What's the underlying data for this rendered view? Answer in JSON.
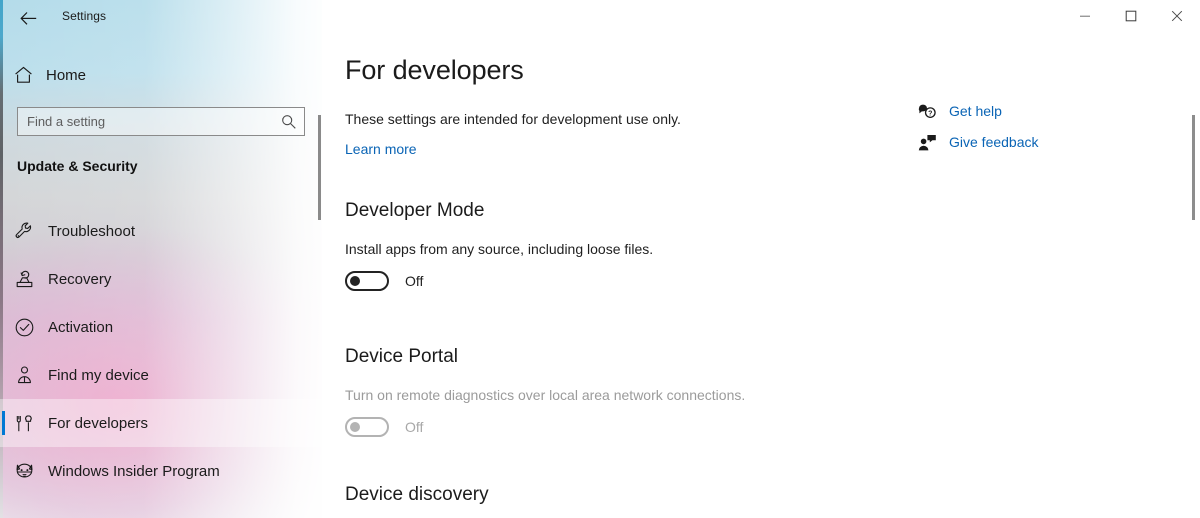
{
  "window": {
    "title": "Settings",
    "back_icon": "back-arrow-icon",
    "controls": {
      "minimize": "─",
      "maximize": "□",
      "close": "✕"
    }
  },
  "sidebar": {
    "home": {
      "label": "Home",
      "icon": "home-icon"
    },
    "search": {
      "value": "",
      "placeholder": "Find a setting",
      "icon": "search-icon"
    },
    "section_header": "Update & Security",
    "items": [
      {
        "label": "Troubleshoot",
        "icon": "wrench-icon",
        "selected": false
      },
      {
        "label": "Recovery",
        "icon": "recovery-icon",
        "selected": false
      },
      {
        "label": "Activation",
        "icon": "check-circle-icon",
        "selected": false
      },
      {
        "label": "Find my device",
        "icon": "find-device-icon",
        "selected": false
      },
      {
        "label": "For developers",
        "icon": "tools-icon",
        "selected": true
      },
      {
        "label": "Windows Insider Program",
        "icon": "ninjacat-icon",
        "selected": false
      }
    ]
  },
  "main": {
    "page_title": "For developers",
    "description": "These settings are intended for development use only.",
    "learn_more": "Learn more",
    "help_links": [
      {
        "label": "Get help",
        "icon": "help-bubble-icon"
      },
      {
        "label": "Give feedback",
        "icon": "feedback-person-icon"
      }
    ],
    "groups": [
      {
        "title": "Developer Mode",
        "description": "Install apps from any source, including loose files.",
        "toggle_state": "Off",
        "disabled": false
      },
      {
        "title": "Device Portal",
        "description": "Turn on remote diagnostics over local area network connections.",
        "toggle_state": "Off",
        "disabled": true
      },
      {
        "title": "Device discovery",
        "description": "",
        "toggle_state": "",
        "disabled": false
      }
    ]
  },
  "colors": {
    "accent": "#0078d4",
    "link": "#0a64b5",
    "text": "#1b1b1b",
    "disabled_text": "#9b9b9b"
  }
}
